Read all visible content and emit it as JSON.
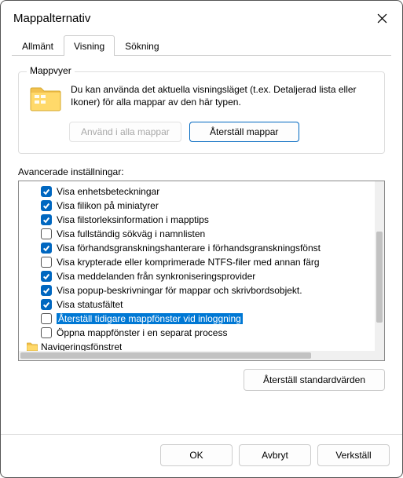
{
  "title": "Mappalternativ",
  "tabs": {
    "general": "Allmänt",
    "view": "Visning",
    "search": "Sökning"
  },
  "folder_views": {
    "group_label": "Mappvyer",
    "description": "Du kan använda det aktuella visningsläget (t.ex. Detaljerad lista eller Ikoner) för alla mappar av den här typen.",
    "apply_btn": "Använd i alla mappar",
    "reset_btn": "Återställ mappar"
  },
  "advanced": {
    "label": "Avancerade inställningar:",
    "items": [
      {
        "checked": true,
        "label": "Visa enhetsbeteckningar"
      },
      {
        "checked": true,
        "label": "Visa filikon på miniatyrer"
      },
      {
        "checked": true,
        "label": "Visa filstorleksinformation i mapptips"
      },
      {
        "checked": false,
        "label": "Visa fullständig sökväg i namnlisten"
      },
      {
        "checked": true,
        "label": "Visa förhandsgranskningshanterare i förhandsgranskningsfönst"
      },
      {
        "checked": false,
        "label": "Visa krypterade eller komprimerade NTFS-filer med annan färg"
      },
      {
        "checked": true,
        "label": "Visa meddelanden från synkroniseringsprovider"
      },
      {
        "checked": true,
        "label": "Visa popup-beskrivningar för mappar och skrivbordsobjekt."
      },
      {
        "checked": true,
        "label": "Visa statusfältet"
      },
      {
        "checked": false,
        "label": "Återställ tidigare mappfönster vid inloggning",
        "selected": true
      },
      {
        "checked": false,
        "label": "Öppna mappfönster i en separat process"
      }
    ],
    "tree_root": "Navigeringsfönstret"
  },
  "reset_defaults": "Återställ standardvärden",
  "buttons": {
    "ok": "OK",
    "cancel": "Avbryt",
    "apply": "Verkställ"
  }
}
